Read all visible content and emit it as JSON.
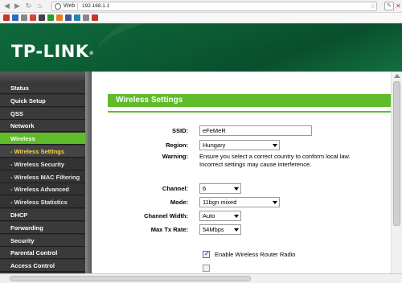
{
  "browser": {
    "scheme_label": "Web",
    "url": "192.168.1.1",
    "bookmark_colors": [
      "#c0392b",
      "#2b6bc0",
      "#888888",
      "#d44638",
      "#444444",
      "#2a9d2a",
      "#e67e22",
      "#3b5998",
      "#2980b9",
      "#888888",
      "#c0392b"
    ]
  },
  "header": {
    "logo_text": "TP-LINK",
    "logo_mark": "®",
    "brand_color": "#0b5a33"
  },
  "sidebar": {
    "items": [
      {
        "label": "Status",
        "type": "top",
        "active": false
      },
      {
        "label": "Quick Setup",
        "type": "top",
        "active": false
      },
      {
        "label": "QSS",
        "type": "top",
        "active": false
      },
      {
        "label": "Network",
        "type": "top",
        "active": false
      },
      {
        "label": "Wireless",
        "type": "top",
        "active": true
      },
      {
        "label": "- Wireless Settings",
        "type": "sub",
        "active": true
      },
      {
        "label": "- Wireless Security",
        "type": "sub",
        "active": false
      },
      {
        "label": "- Wireless MAC Filtering",
        "type": "sub",
        "active": false
      },
      {
        "label": "- Wireless Advanced",
        "type": "sub",
        "active": false
      },
      {
        "label": "- Wireless Statistics",
        "type": "sub",
        "active": false
      },
      {
        "label": "DHCP",
        "type": "top",
        "active": false
      },
      {
        "label": "Forwarding",
        "type": "top",
        "active": false
      },
      {
        "label": "Security",
        "type": "top",
        "active": false
      },
      {
        "label": "Parental Control",
        "type": "top",
        "active": false
      },
      {
        "label": "Access Control",
        "type": "top",
        "active": false
      }
    ]
  },
  "main": {
    "title": "Wireless Settings",
    "ssid_label": "SSID:",
    "ssid_value": "eFeMeR",
    "region_label": "Region:",
    "region_value": "Hungary",
    "warning_label": "Warning:",
    "warning_line1": "Ensure you select a correct country to conform local law.",
    "warning_line2": "Incorrect settings may cause interference.",
    "channel_label": "Channel:",
    "channel_value": "6",
    "mode_label": "Mode:",
    "mode_value": "11bgn mixed",
    "width_label": "Channel Width:",
    "width_value": "Auto",
    "rate_label": "Max Tx Rate:",
    "rate_value": "54Mbps",
    "enable_radio_label": "Enable Wireless Router Radio",
    "enable_radio_checked": true
  },
  "colors": {
    "accent": "#5fbb2a",
    "active_sub_text": "#ffd24d"
  }
}
